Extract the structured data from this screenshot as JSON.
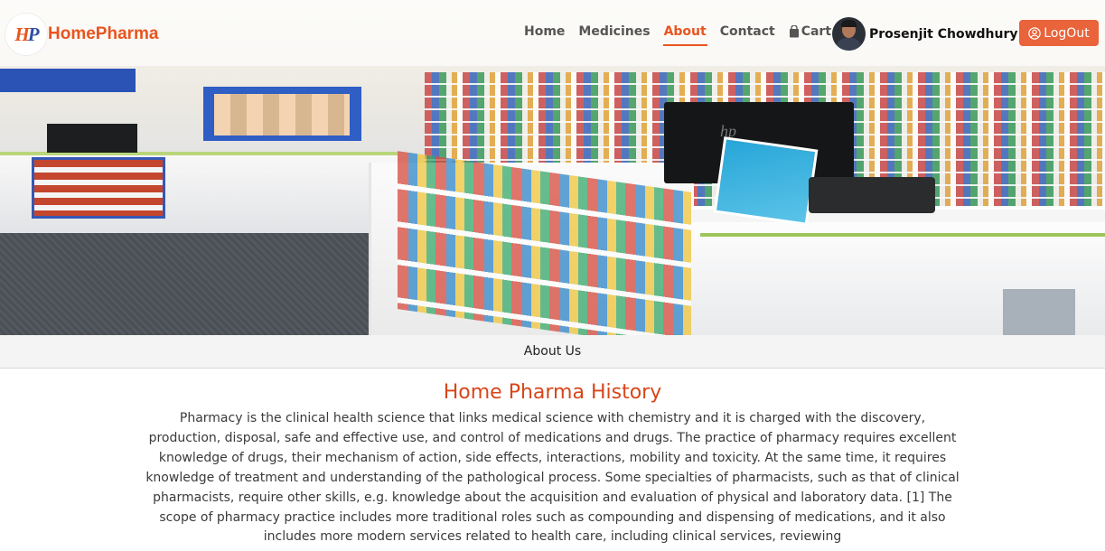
{
  "brand": {
    "logo_text": "HP",
    "name": "HomePharma",
    "color": "#e8551f"
  },
  "nav": {
    "items": [
      {
        "label": "Home",
        "active": false
      },
      {
        "label": "Medicines",
        "active": false
      },
      {
        "label": "About",
        "active": true
      },
      {
        "label": "Contact",
        "active": false
      }
    ],
    "cart_label": "Cart",
    "cart_icon": "shopping-bag-icon"
  },
  "user": {
    "name": "Prosenjit Chowdhury",
    "avatar_icon": "user-photo"
  },
  "logout": {
    "label": "LogOut",
    "icon": "user-circle-icon",
    "color": "#e9633b"
  },
  "about_bar": {
    "label": "About Us"
  },
  "history": {
    "title": "Home Pharma History",
    "text": "Pharmacy is the clinical health science that links medical science with chemistry and it is charged with the discovery, production, disposal, safe and effective use, and control of medications and drugs. The practice of pharmacy requires excellent knowledge of drugs, their mechanism of action, side effects, interactions, mobility and toxicity. At the same time, it requires knowledge of treatment and understanding of the pathological process. Some specialties of pharmacists, such as that of clinical pharmacists, require other skills, e.g. knowledge about the acquisition and evaluation of physical and laboratory data. [1] The scope of pharmacy practice includes more traditional roles such as compounding and dispensing of medications, and it also includes more modern services related to health care, including clinical services, reviewing",
    "title_color": "#d8461a"
  }
}
